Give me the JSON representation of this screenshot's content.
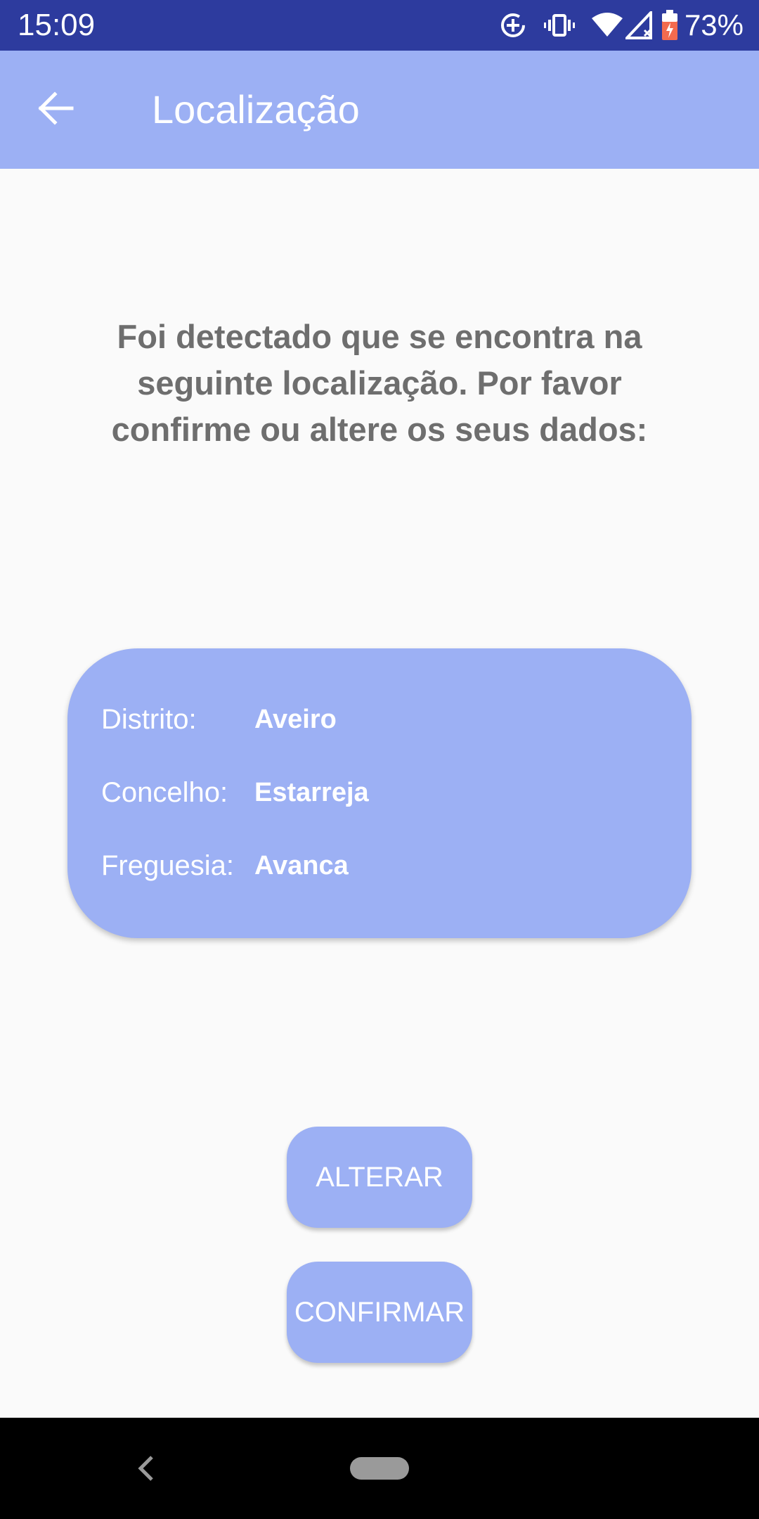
{
  "status_bar": {
    "time": "15:09",
    "battery_percent": "73%",
    "icons": [
      "data-saver-icon",
      "vibrate-icon",
      "wifi-icon",
      "cellular-no-signal-icon",
      "battery-charging-icon"
    ]
  },
  "app_bar": {
    "title": "Localização",
    "back_icon": "arrow-left-icon"
  },
  "main": {
    "intro_text": "Foi detectado que se encontra na seguinte localização. Por favor confirme ou altere os seus dados:",
    "location": {
      "district_label": "Distrito:",
      "district_value": "Aveiro",
      "municipality_label": "Concelho:",
      "municipality_value": "Estarreja",
      "parish_label": "Freguesia:",
      "parish_value": "Avanca"
    },
    "alter_button": "ALTERAR",
    "confirm_button": "CONFIRMAR"
  },
  "nav_bar": {
    "back_icon": "nav-back-icon",
    "home_icon": "nav-home-pill-icon"
  },
  "colors": {
    "status_bar": "#2d3b9e",
    "accent": "#9cb0f4",
    "text_muted": "#6e6e6e",
    "background": "#fafafa"
  }
}
